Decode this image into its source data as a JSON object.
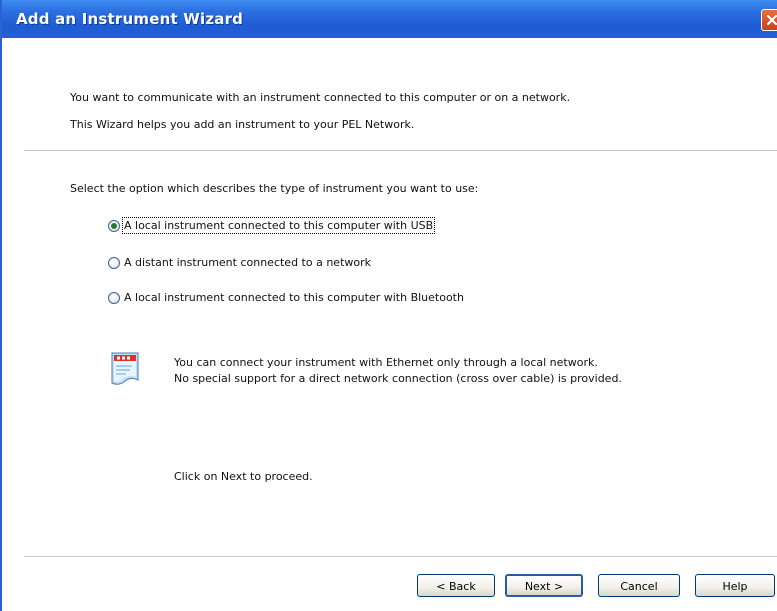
{
  "window": {
    "title": "Add an Instrument Wizard"
  },
  "intro": {
    "line1": "You want to communicate with an instrument connected to this computer or on a network.",
    "line2": "This Wizard helps you add an instrument to your PEL Network."
  },
  "options": {
    "prompt": "Select the option which describes the type of instrument you want to use:",
    "items": [
      {
        "label": "A local instrument connected to this computer with USB",
        "checked": true
      },
      {
        "label": "A distant instrument connected to a network",
        "checked": false
      },
      {
        "label": "A local instrument connected to this computer with Bluetooth",
        "checked": false
      }
    ]
  },
  "info": {
    "line1": "You can connect your instrument with Ethernet only through a local network.",
    "line2": "No special support for a direct network connection (cross over cable) is provided."
  },
  "proceed_text": "Click on Next to proceed.",
  "buttons": {
    "back": "< Back",
    "next": "Next >",
    "cancel": "Cancel",
    "help": "Help"
  },
  "colors": {
    "titlebar": "#2b6fe0",
    "close_button": "#d9521f",
    "radio_checked": "#2b7a2b"
  },
  "icons": {
    "close": "close-icon",
    "info": "info-document-icon"
  }
}
